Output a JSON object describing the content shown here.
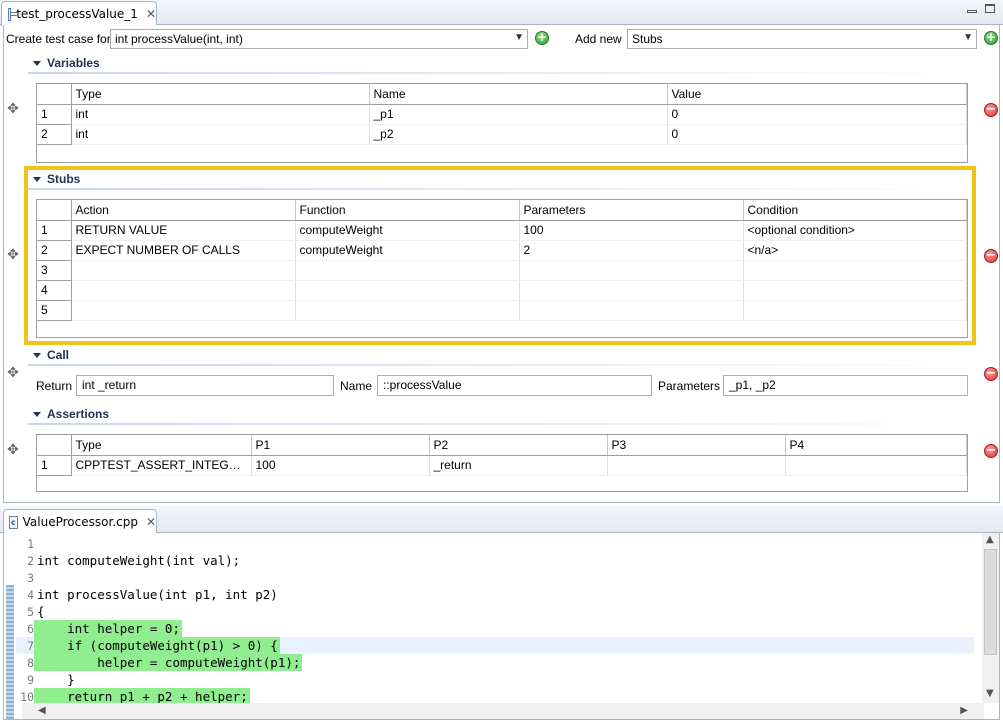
{
  "top_editor": {
    "tab_label": "test_processValue_1",
    "create_label": "Create test case for",
    "function_combo": "int processValue(int, int)",
    "add_new_label": "Add new",
    "add_new_combo": "Stubs"
  },
  "variables": {
    "title": "Variables",
    "headers": [
      "Type",
      "Name",
      "Value"
    ],
    "rows": [
      {
        "n": "1",
        "type": "int",
        "name": "_p1",
        "value": "0"
      },
      {
        "n": "2",
        "type": "int",
        "name": "_p2",
        "value": "0"
      }
    ]
  },
  "stubs": {
    "title": "Stubs",
    "headers": [
      "Action",
      "Function",
      "Parameters",
      "Condition"
    ],
    "rows": [
      {
        "n": "1",
        "action": "RETURN VALUE",
        "function": "computeWeight",
        "parameters": "100",
        "condition": "<optional condition>"
      },
      {
        "n": "2",
        "action": "EXPECT NUMBER OF CALLS",
        "function": "computeWeight",
        "parameters": "2",
        "condition": "<n/a>"
      },
      {
        "n": "3",
        "action": "",
        "function": "",
        "parameters": "",
        "condition": ""
      },
      {
        "n": "4",
        "action": "",
        "function": "",
        "parameters": "",
        "condition": ""
      },
      {
        "n": "5",
        "action": "",
        "function": "",
        "parameters": "",
        "condition": ""
      }
    ]
  },
  "call": {
    "title": "Call",
    "return_label": "Return",
    "return_value": "int _return",
    "name_label": "Name",
    "name_value": "::processValue",
    "parameters_label": "Parameters",
    "parameters_value": "_p1, _p2"
  },
  "assertions": {
    "title": "Assertions",
    "headers": [
      "Type",
      "P1",
      "P2",
      "P3",
      "P4"
    ],
    "rows": [
      {
        "n": "1",
        "type": "CPPTEST_ASSERT_INTEGER_E...",
        "p1": "100",
        "p2": "_return",
        "p3": "",
        "p4": ""
      }
    ]
  },
  "code_editor": {
    "tab_label": "ValueProcessor.cpp",
    "lines": [
      {
        "n": "1",
        "text": ""
      },
      {
        "n": "2",
        "text": "int computeWeight(int val);"
      },
      {
        "n": "3",
        "text": ""
      },
      {
        "n": "4",
        "text": "int processValue(int p1, int p2)"
      },
      {
        "n": "5",
        "text": "{"
      },
      {
        "n": "6",
        "text": "    int helper = 0;"
      },
      {
        "n": "7",
        "text": "    if (computeWeight(p1) > 0) {"
      },
      {
        "n": "8",
        "text": "        helper = computeWeight(p1);"
      },
      {
        "n": "9",
        "text": "    }"
      },
      {
        "n": "10",
        "text": "    return p1 + p2 + helper;"
      }
    ]
  },
  "colors": {
    "highlight_border": "#f0c419",
    "coverage_green": "#90ee90",
    "section_title": "#1f3155"
  }
}
